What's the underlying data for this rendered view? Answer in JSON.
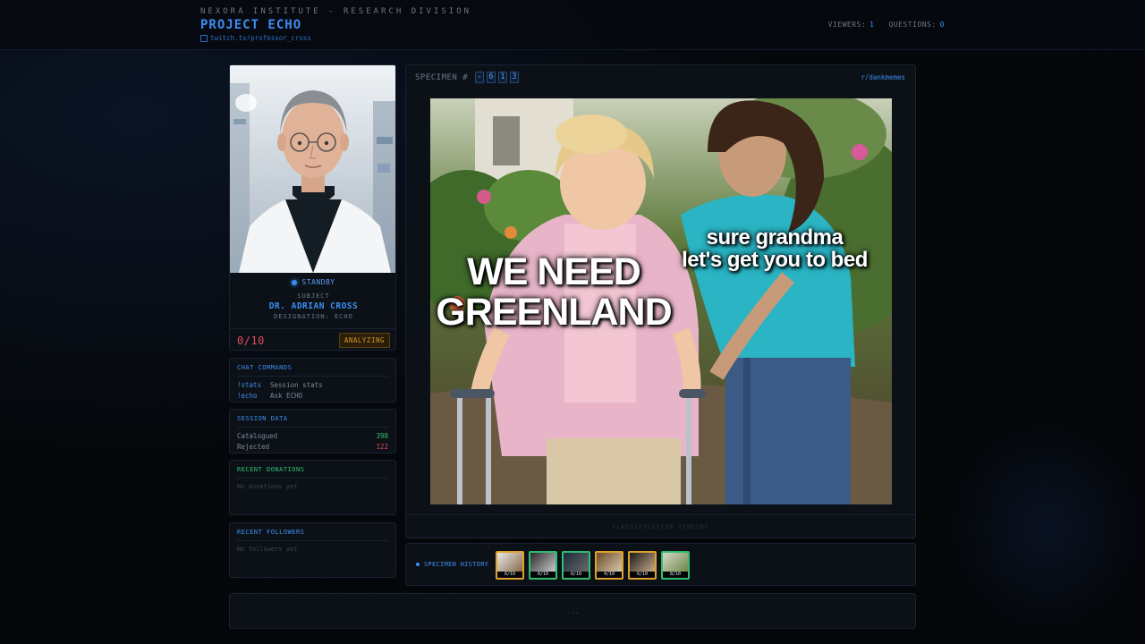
{
  "header": {
    "org": "NEXORA INSTITUTE - RESEARCH DIVISION",
    "title": "PROJECT ECHO",
    "link": "twitch.tv/professor_cross",
    "viewers_label": "VIEWERS:",
    "viewers": "1",
    "questions_label": "QUESTIONS:",
    "questions": "0"
  },
  "profile": {
    "status": "STANDBY",
    "subject_label": "SUBJECT",
    "name": "DR. ADRIAN CROSS",
    "designation": "DESIGNATION: ECHO",
    "score": "0/10",
    "analysis_status": "ANALYZING"
  },
  "commands": {
    "title": "CHAT COMMANDS",
    "items": [
      {
        "cmd": "!stats",
        "desc": "Session stats"
      },
      {
        "cmd": "!echo",
        "desc": "Ask ECHO"
      }
    ]
  },
  "session": {
    "title": "SESSION DATA",
    "catalogued_label": "Catalogued",
    "catalogued": "398",
    "rejected_label": "Rejected",
    "rejected": "122"
  },
  "donations": {
    "title": "RECENT DONATIONS",
    "empty": "No donations yet"
  },
  "followers": {
    "title": "RECENT FOLLOWERS",
    "empty": "No followers yet"
  },
  "specimen": {
    "label": "SPECIMEN #",
    "digits": [
      "-",
      "6",
      "1",
      "3"
    ],
    "source": "r/dankmemes",
    "meme_left_line1": "WE NEED",
    "meme_left_line2": "GREENLAND",
    "meme_right_line1": "sure grandma",
    "meme_right_line2": "let's get you to bed",
    "classification": "CLASSIFICATION PENDING"
  },
  "history": {
    "label": "SPECIMEN HISTORY",
    "items": [
      {
        "score": "6/10",
        "border": "amber"
      },
      {
        "score": "8/10",
        "border": "green"
      },
      {
        "score": "8/10",
        "border": "green"
      },
      {
        "score": "4/10",
        "border": "amber"
      },
      {
        "score": "6/10",
        "border": "amber"
      },
      {
        "score": "8/10",
        "border": "green"
      }
    ]
  },
  "bottom": {
    "text": "..."
  },
  "colors": {
    "accent": "#3d8ef0",
    "danger": "#e04a5a",
    "success": "#2fbf71",
    "warning": "#e0a32a"
  }
}
